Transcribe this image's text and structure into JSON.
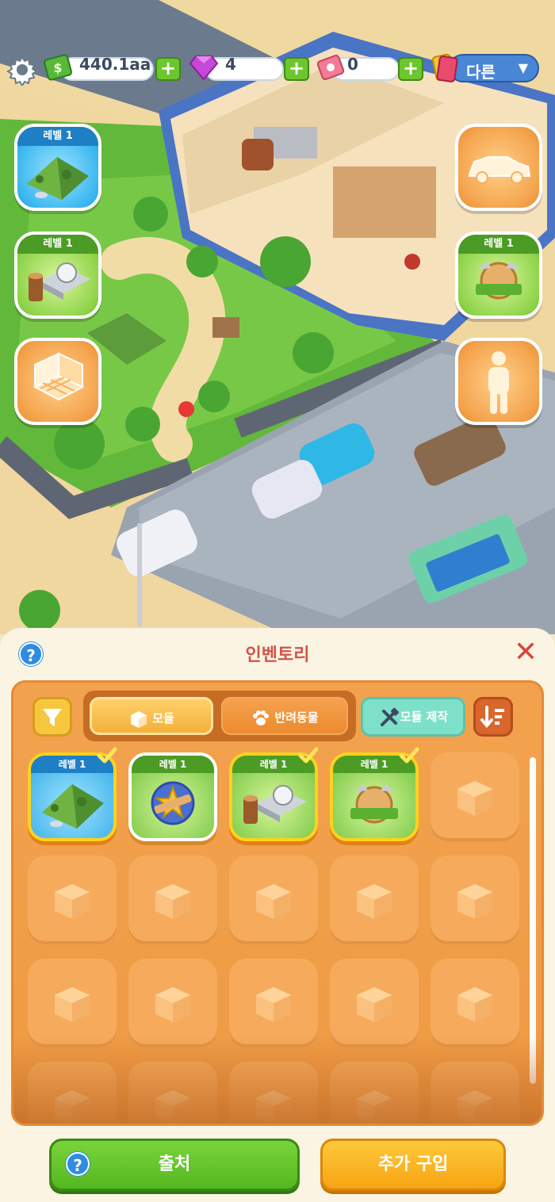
{
  "hud": {
    "cash": "440.1aa",
    "gems": "4",
    "tickets": "0",
    "plus_label": "+",
    "dropdown_label": "다른"
  },
  "side_buttons": {
    "left": [
      {
        "level": "레벨 1",
        "icon": "tent-icon"
      },
      {
        "level": "레벨 1",
        "icon": "sawmill-icon"
      },
      {
        "level": "",
        "icon": "floor-grid-icon"
      }
    ],
    "right": [
      {
        "level": "",
        "icon": "car-icon"
      },
      {
        "level": "레벨 1",
        "icon": "lumberjack-badge-icon"
      },
      {
        "level": "",
        "icon": "person-icon"
      }
    ]
  },
  "inventory": {
    "title": "인벤토리",
    "tabs": [
      {
        "label": "모듈",
        "active": true
      },
      {
        "label": "반려동물",
        "active": false
      }
    ],
    "craft_label": "모듈 제작",
    "items": [
      {
        "level": "레벨 1",
        "icon": "tent-icon",
        "bg": "blue",
        "selected": true
      },
      {
        "level": "레벨 1",
        "icon": "sheriff-badge-icon",
        "bg": "green",
        "selected": false
      },
      {
        "level": "레벨 1",
        "icon": "sawmill-icon",
        "bg": "green",
        "selected": true
      },
      {
        "level": "레벨 1",
        "icon": "lumberjack-badge-icon",
        "bg": "green",
        "selected": true
      }
    ],
    "empty_slots": 16,
    "source_button": "출처",
    "buy_more_button": "추가 구입",
    "help_label": "?",
    "close_label": "✕"
  },
  "colors": {
    "accent_orange": "#f2a24e",
    "title_red": "#d1544a",
    "green_button": "#6cc62e",
    "blue_dropdown": "#4a86d6"
  }
}
